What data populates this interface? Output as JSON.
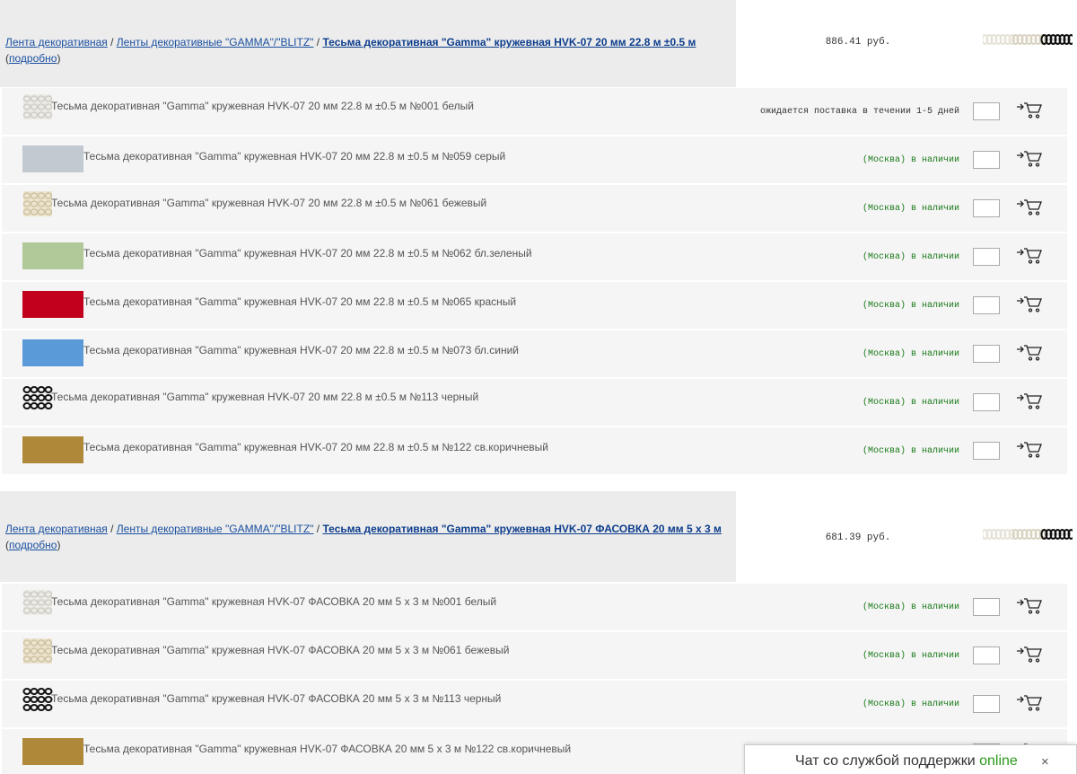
{
  "groups": [
    {
      "breadcrumb": [
        "Лента декоративная",
        "Ленты декоративные \"GAMMA\"/\"BLITZ\""
      ],
      "separator": " / ",
      "title": "Тесьма декоративная \"Gamma\" кружевная HVK-07 20 мм 22.8 м ±0.5 м",
      "more_label": "подробно",
      "price": "886.41 руб.",
      "items": [
        {
          "name": "Тесьма декоративная \"Gamma\" кружевная HVK-07 20 мм 22.8 м ±0.5 м №001 белый",
          "status": "ожидается поставка в течении 1-5 дней",
          "status_type": "wait",
          "swatch": "lace-white"
        },
        {
          "name": "Тесьма декоративная \"Gamma\" кружевная HVK-07 20 мм 22.8 м ±0.5 м №059 серый",
          "status": "(Москва) в наличии",
          "status_type": "avail",
          "swatch": "#c3c9d1"
        },
        {
          "name": "Тесьма декоративная \"Gamma\" кружевная HVK-07 20 мм 22.8 м ±0.5 м №061 бежевый",
          "status": "(Москва) в наличии",
          "status_type": "avail",
          "swatch": "lace-beige"
        },
        {
          "name": "Тесьма декоративная \"Gamma\" кружевная HVK-07 20 мм 22.8 м ±0.5 м №062 бл.зеленый",
          "status": "(Москва) в наличии",
          "status_type": "avail",
          "swatch": "#b1c898"
        },
        {
          "name": "Тесьма декоративная \"Gamma\" кружевная HVK-07 20 мм 22.8 м ±0.5 м №065 красный",
          "status": "(Москва) в наличии",
          "status_type": "avail",
          "swatch": "#c2001e"
        },
        {
          "name": "Тесьма декоративная \"Gamma\" кружевная HVK-07 20 мм 22.8 м ±0.5 м №073 бл.синий",
          "status": "(Москва) в наличии",
          "status_type": "avail",
          "swatch": "#5b9ad8"
        },
        {
          "name": "Тесьма декоративная \"Gamma\" кружевная HVK-07 20 мм 22.8 м ±0.5 м №113 черный",
          "status": "(Москва) в наличии",
          "status_type": "avail",
          "swatch": "lace-black"
        },
        {
          "name": "Тесьма декоративная \"Gamma\" кружевная HVK-07 20 мм 22.8 м ±0.5 м №122 св.коричневый",
          "status": "(Москва) в наличии",
          "status_type": "avail",
          "swatch": "#b0883a"
        }
      ]
    },
    {
      "breadcrumb": [
        "Лента декоративная",
        "Ленты декоративные \"GAMMA\"/\"BLITZ\""
      ],
      "separator": " / ",
      "title": "Тесьма декоративная \"Gamma\" кружевная HVK-07 ФАСОВКА 20 мм 5 х 3 м",
      "more_label": "подробно",
      "price": "681.39 руб.",
      "items": [
        {
          "name": "Тесьма декоративная \"Gamma\" кружевная HVK-07 ФАСОВКА 20 мм 5 х 3 м №001 белый",
          "status": "(Москва) в наличии",
          "status_type": "avail",
          "swatch": "lace-white"
        },
        {
          "name": "Тесьма декоративная \"Gamma\" кружевная HVK-07 ФАСОВКА 20 мм 5 х 3 м №061 бежевый",
          "status": "(Москва) в наличии",
          "status_type": "avail",
          "swatch": "lace-beige"
        },
        {
          "name": "Тесьма декоративная \"Gamma\" кружевная HVK-07 ФАСОВКА 20 мм 5 х 3 м №113 черный",
          "status": "(Москва) в наличии",
          "status_type": "avail",
          "swatch": "lace-black"
        },
        {
          "name": "Тесьма декоративная \"Gamma\" кружевная HVK-07 ФАСОВКА 20 мм 5 х 3 м №122 св.коричневый",
          "status": "",
          "status_type": "avail",
          "swatch": "#b0883a"
        }
      ]
    }
  ],
  "chat": {
    "label": "Чат со службой поддержки",
    "online": "online",
    "close": "×"
  },
  "icons": {
    "cart": "cart-icon",
    "close": "close-icon"
  }
}
